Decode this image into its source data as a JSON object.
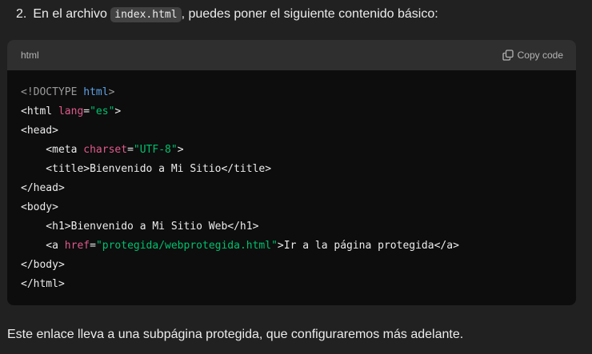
{
  "step": {
    "number": "2.",
    "text_before": "En el archivo ",
    "inline_code": "index.html",
    "text_after": ", puedes poner el siguiente contenido básico:"
  },
  "code_block": {
    "language": "html",
    "copy_label": "Copy code",
    "copy_icon": "copy-icon",
    "lines": [
      [
        {
          "t": "<!DOCTYPE ",
          "c": "muted"
        },
        {
          "t": "html",
          "c": "kw"
        },
        {
          "t": ">",
          "c": "muted"
        }
      ],
      [
        {
          "t": "<html ",
          "c": "plain"
        },
        {
          "t": "lang",
          "c": "attr"
        },
        {
          "t": "=",
          "c": "plain"
        },
        {
          "t": "\"es\"",
          "c": "str"
        },
        {
          "t": ">",
          "c": "plain"
        }
      ],
      [
        {
          "t": "<head>",
          "c": "plain"
        }
      ],
      [
        {
          "t": "    <meta ",
          "c": "plain"
        },
        {
          "t": "charset",
          "c": "attr"
        },
        {
          "t": "=",
          "c": "plain"
        },
        {
          "t": "\"UTF-8\"",
          "c": "str"
        },
        {
          "t": ">",
          "c": "plain"
        }
      ],
      [
        {
          "t": "    <title>Bienvenido a Mi Sitio</title>",
          "c": "plain"
        }
      ],
      [
        {
          "t": "</head>",
          "c": "plain"
        }
      ],
      [
        {
          "t": "<body>",
          "c": "plain"
        }
      ],
      [
        {
          "t": "    <h1>Bienvenido a Mi Sitio Web</h1>",
          "c": "plain"
        }
      ],
      [
        {
          "t": "    <a ",
          "c": "plain"
        },
        {
          "t": "href",
          "c": "attr"
        },
        {
          "t": "=",
          "c": "plain"
        },
        {
          "t": "\"protegida/webprotegida.html\"",
          "c": "str"
        },
        {
          "t": ">Ir a la página protegida</a>",
          "c": "plain"
        }
      ],
      [
        {
          "t": "</body>",
          "c": "plain"
        }
      ],
      [
        {
          "t": "</html>",
          "c": "plain"
        }
      ]
    ]
  },
  "note": "Este enlace lleva a una subpágina protegida, que configuraremos más adelante.",
  "colors": {
    "background": "#212121",
    "code_bg": "#0d0d0d",
    "header_bg": "#2f2f2f",
    "keyword": "#5ea2e6",
    "attribute": "#e0598c",
    "string": "#00c06e"
  }
}
